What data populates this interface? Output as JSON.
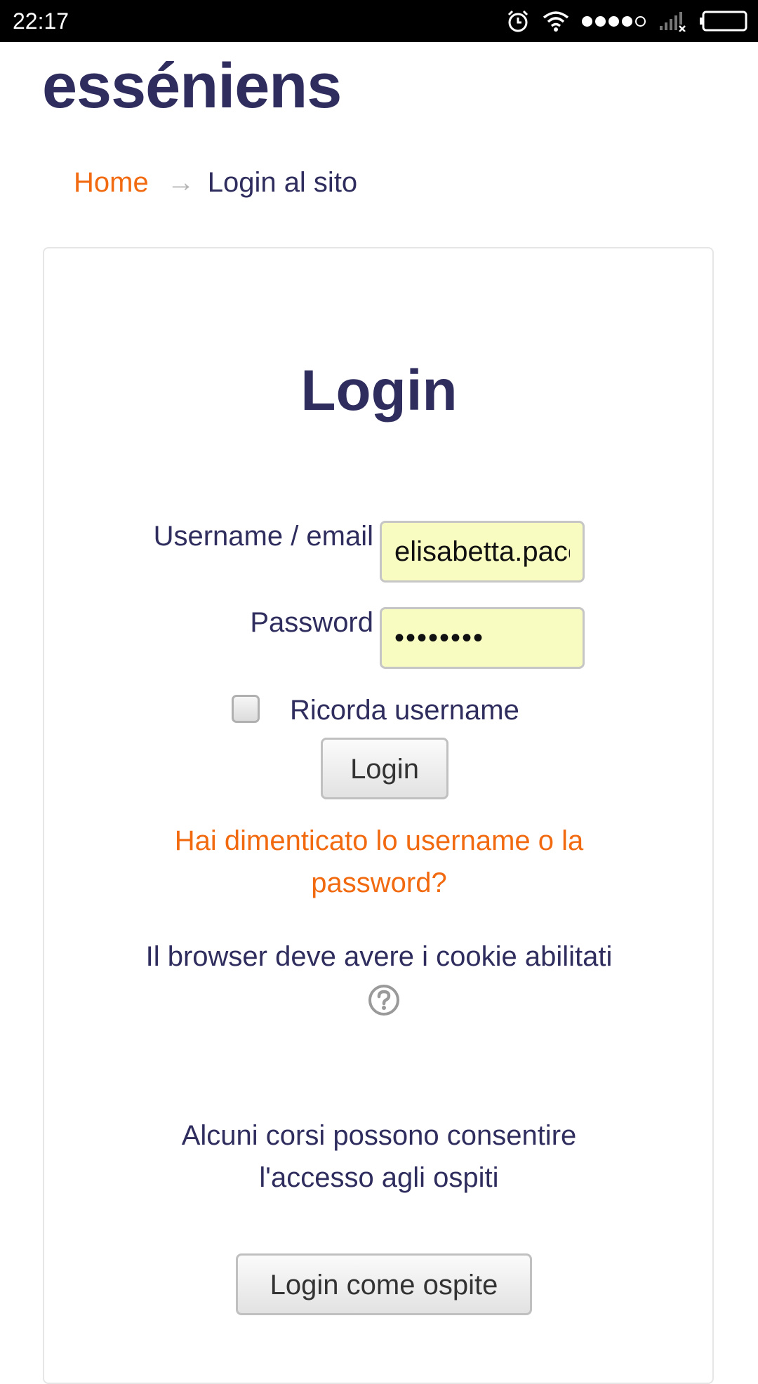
{
  "status_bar": {
    "time": "22:17",
    "icons": [
      "alarm-icon",
      "wifi-icon",
      "signal-dots-icon",
      "cellular-no-service-icon",
      "battery-icon"
    ]
  },
  "site": {
    "title": "esséniens"
  },
  "breadcrumb": {
    "home": "Home",
    "arrow": "→",
    "current": "Login al sito"
  },
  "login": {
    "heading": "Login",
    "username_label": "Username / email",
    "username_value": "elisabetta.pace",
    "password_label": "Password",
    "password_value": "••••••••",
    "remember_label": "Ricorda username",
    "remember_checked": false,
    "submit_label": "Login",
    "forgot_link": "Hai dimenticato lo username o la password?",
    "cookie_notice": "Il browser deve avere i cookie abilitati",
    "help_icon": "help-icon"
  },
  "guest": {
    "info": "Alcuni corsi possono consentire l'accesso agli ospiti",
    "button_label": "Login come ospite"
  },
  "colors": {
    "primary_text": "#2f2d5e",
    "link": "#f26a10",
    "input_autofill_bg": "#f9fcc0"
  }
}
